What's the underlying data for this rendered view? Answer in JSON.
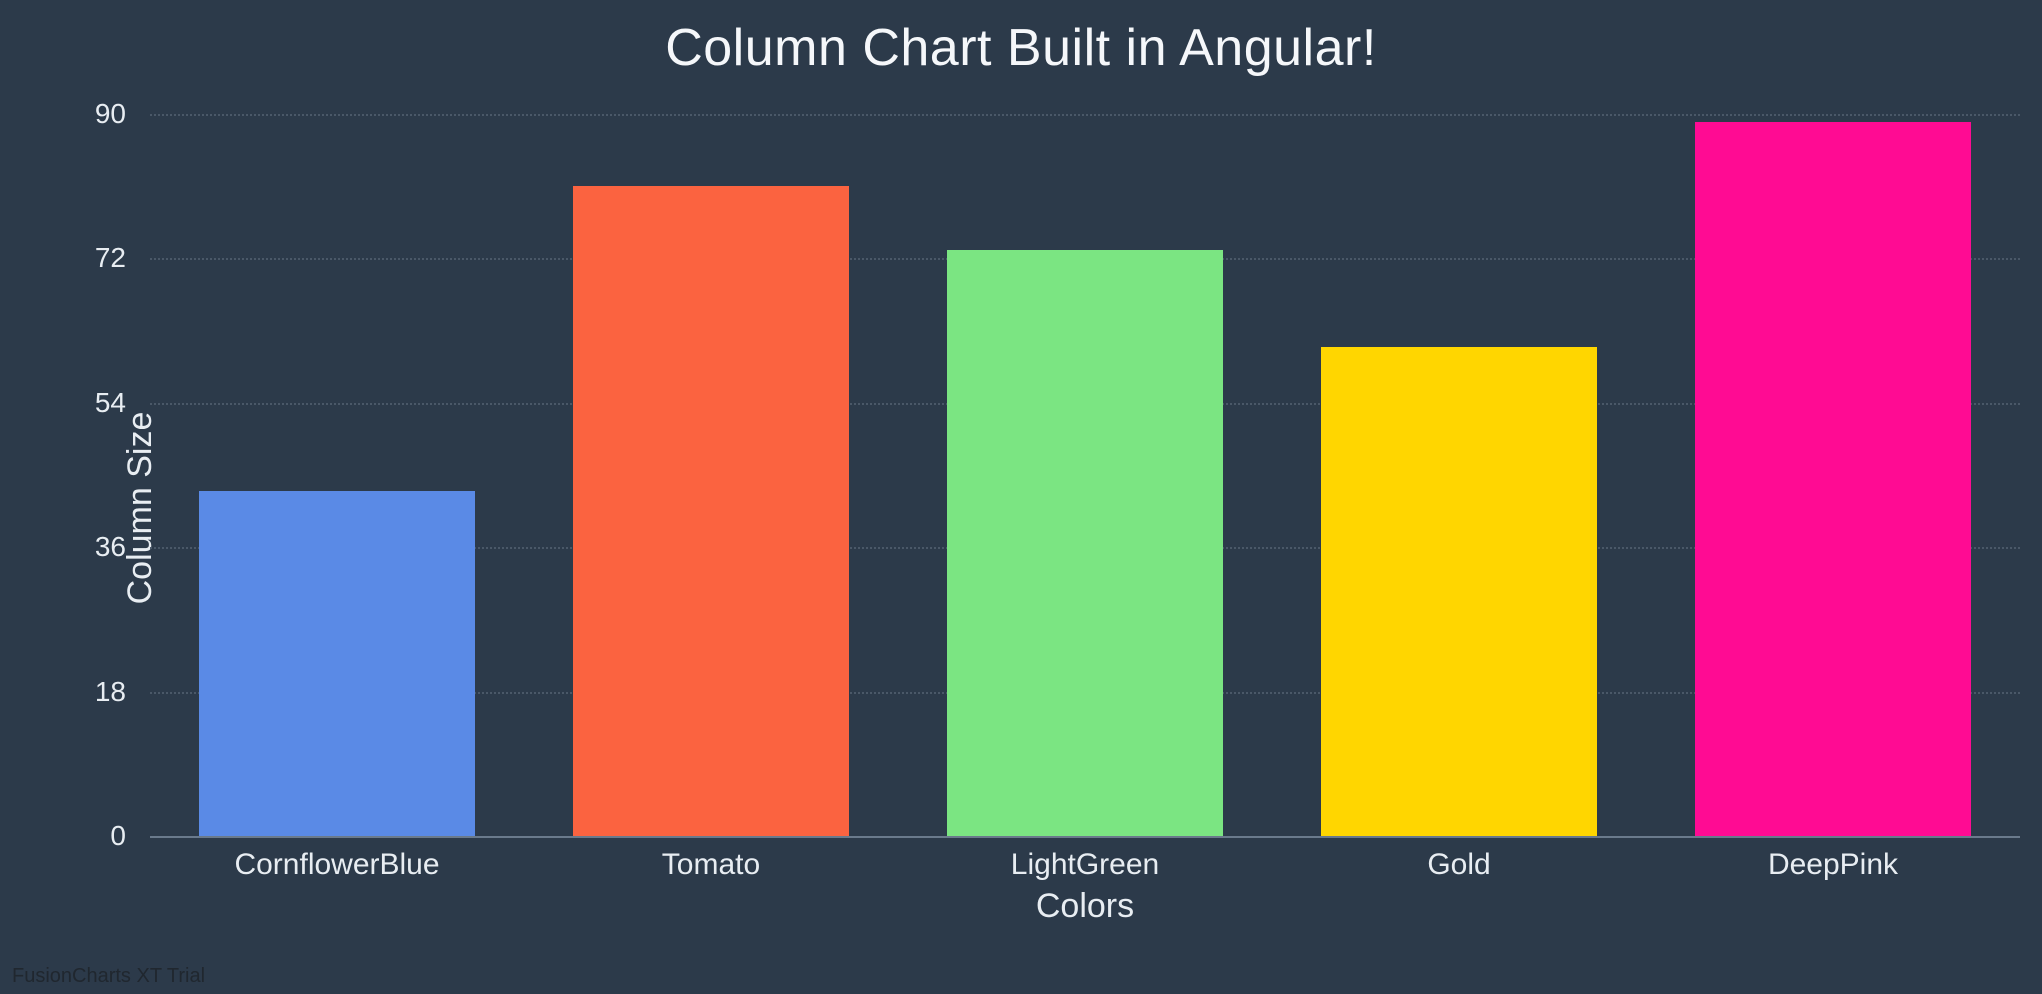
{
  "chart_data": {
    "type": "bar",
    "title": "Column Chart Built in Angular!",
    "xlabel": "Colors",
    "ylabel": "Column Size",
    "categories": [
      "CornflowerBlue",
      "Tomato",
      "LightGreen",
      "Gold",
      "DeepPink"
    ],
    "values": [
      43,
      81,
      73,
      61,
      89
    ],
    "colors": [
      "#5a8ae6",
      "#fb6340",
      "#7be582",
      "#ffd600",
      "#ff0b93"
    ],
    "yticks": [
      0,
      18,
      36,
      54,
      72,
      90
    ],
    "ylim": [
      0,
      90
    ]
  },
  "watermark": "FusionCharts XT Trial"
}
